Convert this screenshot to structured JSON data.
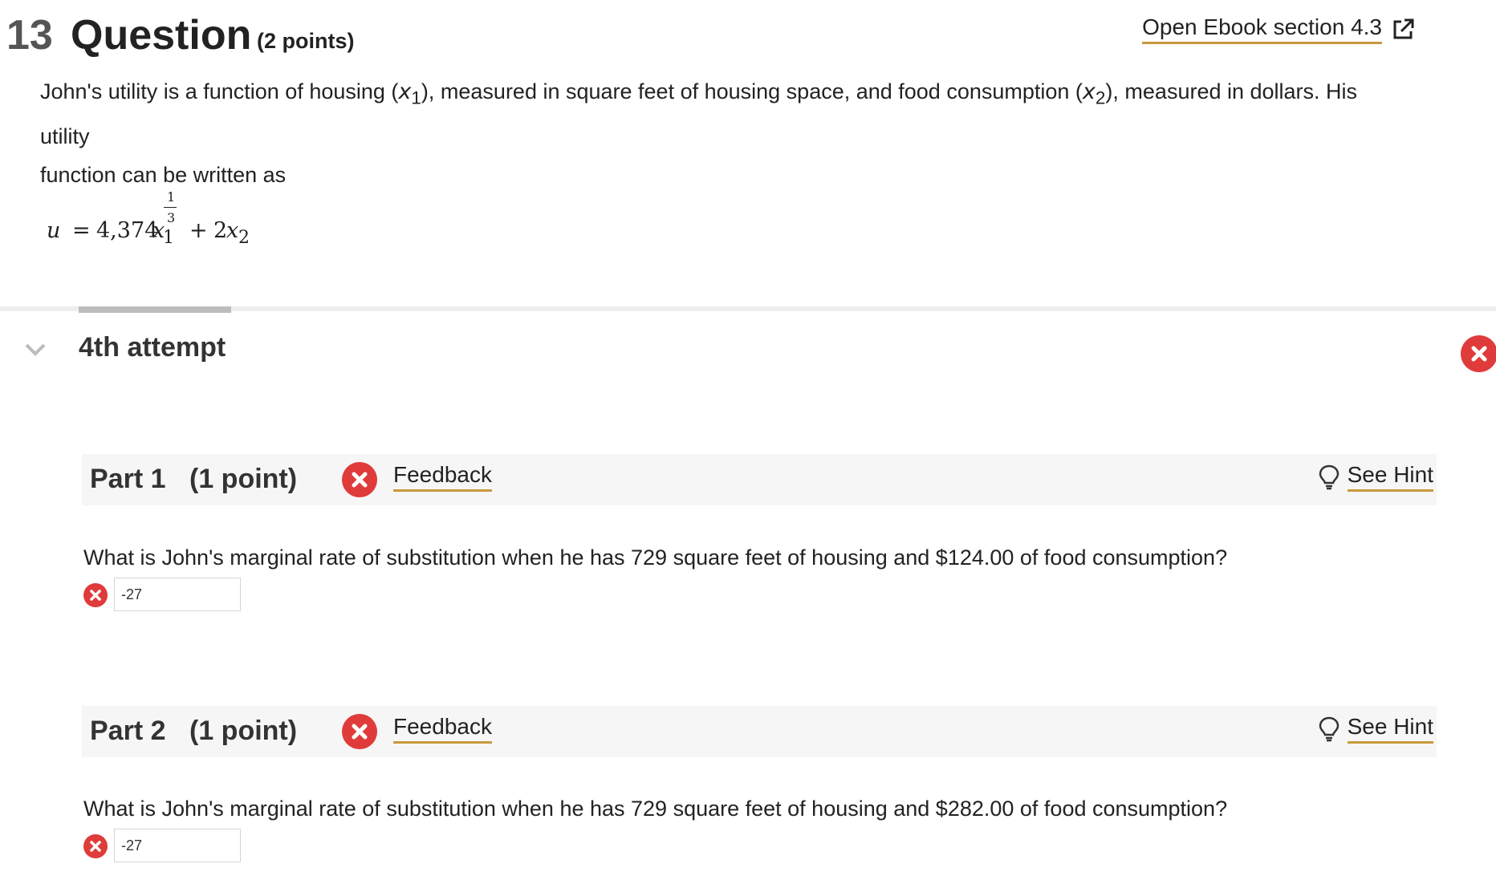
{
  "header": {
    "question_number": "13",
    "question_label": "Question",
    "points": "(2 points)",
    "ebook_link": "Open Ebook section  4.3"
  },
  "intro": {
    "line1_a": "John's utility is a function of housing (",
    "x1": "x",
    "x1_sub": "1",
    "line1_b": "), measured in square feet of housing space, and food consumption (",
    "x2": "x",
    "x2_sub": "2",
    "line1_c": "), measured in dollars. His utility",
    "line2": "function can be written as"
  },
  "formula": {
    "u": "u",
    "eq": "=",
    "coef": "4,374",
    "var1": "x",
    "sub1": "1",
    "exp_num": "1",
    "exp_den": "3",
    "plus": "+",
    "coef2": "2",
    "var2": "x",
    "sub2": "2"
  },
  "attempt": {
    "label": "4th attempt"
  },
  "parts": [
    {
      "title": "Part 1",
      "points": "(1 point)",
      "feedback": "Feedback",
      "hint": "See Hint",
      "question": "What is John's marginal rate of substitution when he has 729 square feet of housing and $124.00 of food consumption?",
      "answer": "-27"
    },
    {
      "title": "Part 2",
      "points": "(1 point)",
      "feedback": "Feedback",
      "hint": "See Hint",
      "question": "What is John's marginal rate of substitution when he has 729 square feet of housing and $282.00 of food consumption?",
      "answer": "-27"
    }
  ],
  "icons": {
    "status": "x-circle-icon",
    "hint": "lightbulb-icon",
    "external": "external-link-icon",
    "expand": "chevron-down-icon"
  },
  "colors": {
    "error": "#e03b3b",
    "link_underline": "#c79a3c"
  }
}
